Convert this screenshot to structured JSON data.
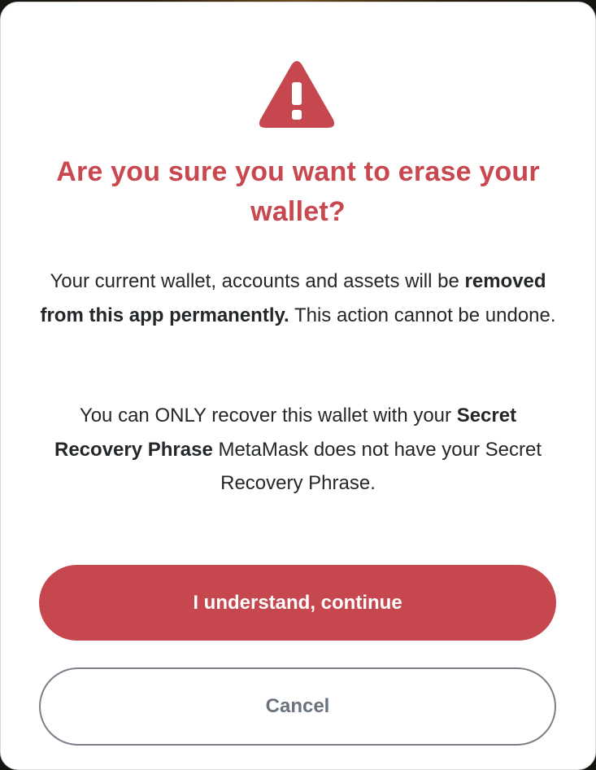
{
  "dialog": {
    "title": "Are you sure you want to erase your wallet?",
    "paragraph1": {
      "text_a": "Your current wallet, accounts and assets will be ",
      "bold": "removed from this app permanently.",
      "text_b": " This action cannot be undone."
    },
    "paragraph2": {
      "text_a": "You can ONLY recover this wallet with your ",
      "bold": "Secret Recovery Phrase",
      "text_b": " MetaMask does not have your Secret Recovery Phrase."
    },
    "primary_button": "I understand, continue",
    "secondary_button": "Cancel"
  },
  "colors": {
    "danger": "#c7474e",
    "text": "#24272a",
    "muted": "#6a737d"
  },
  "icons": {
    "warning": "warning-triangle-icon"
  }
}
